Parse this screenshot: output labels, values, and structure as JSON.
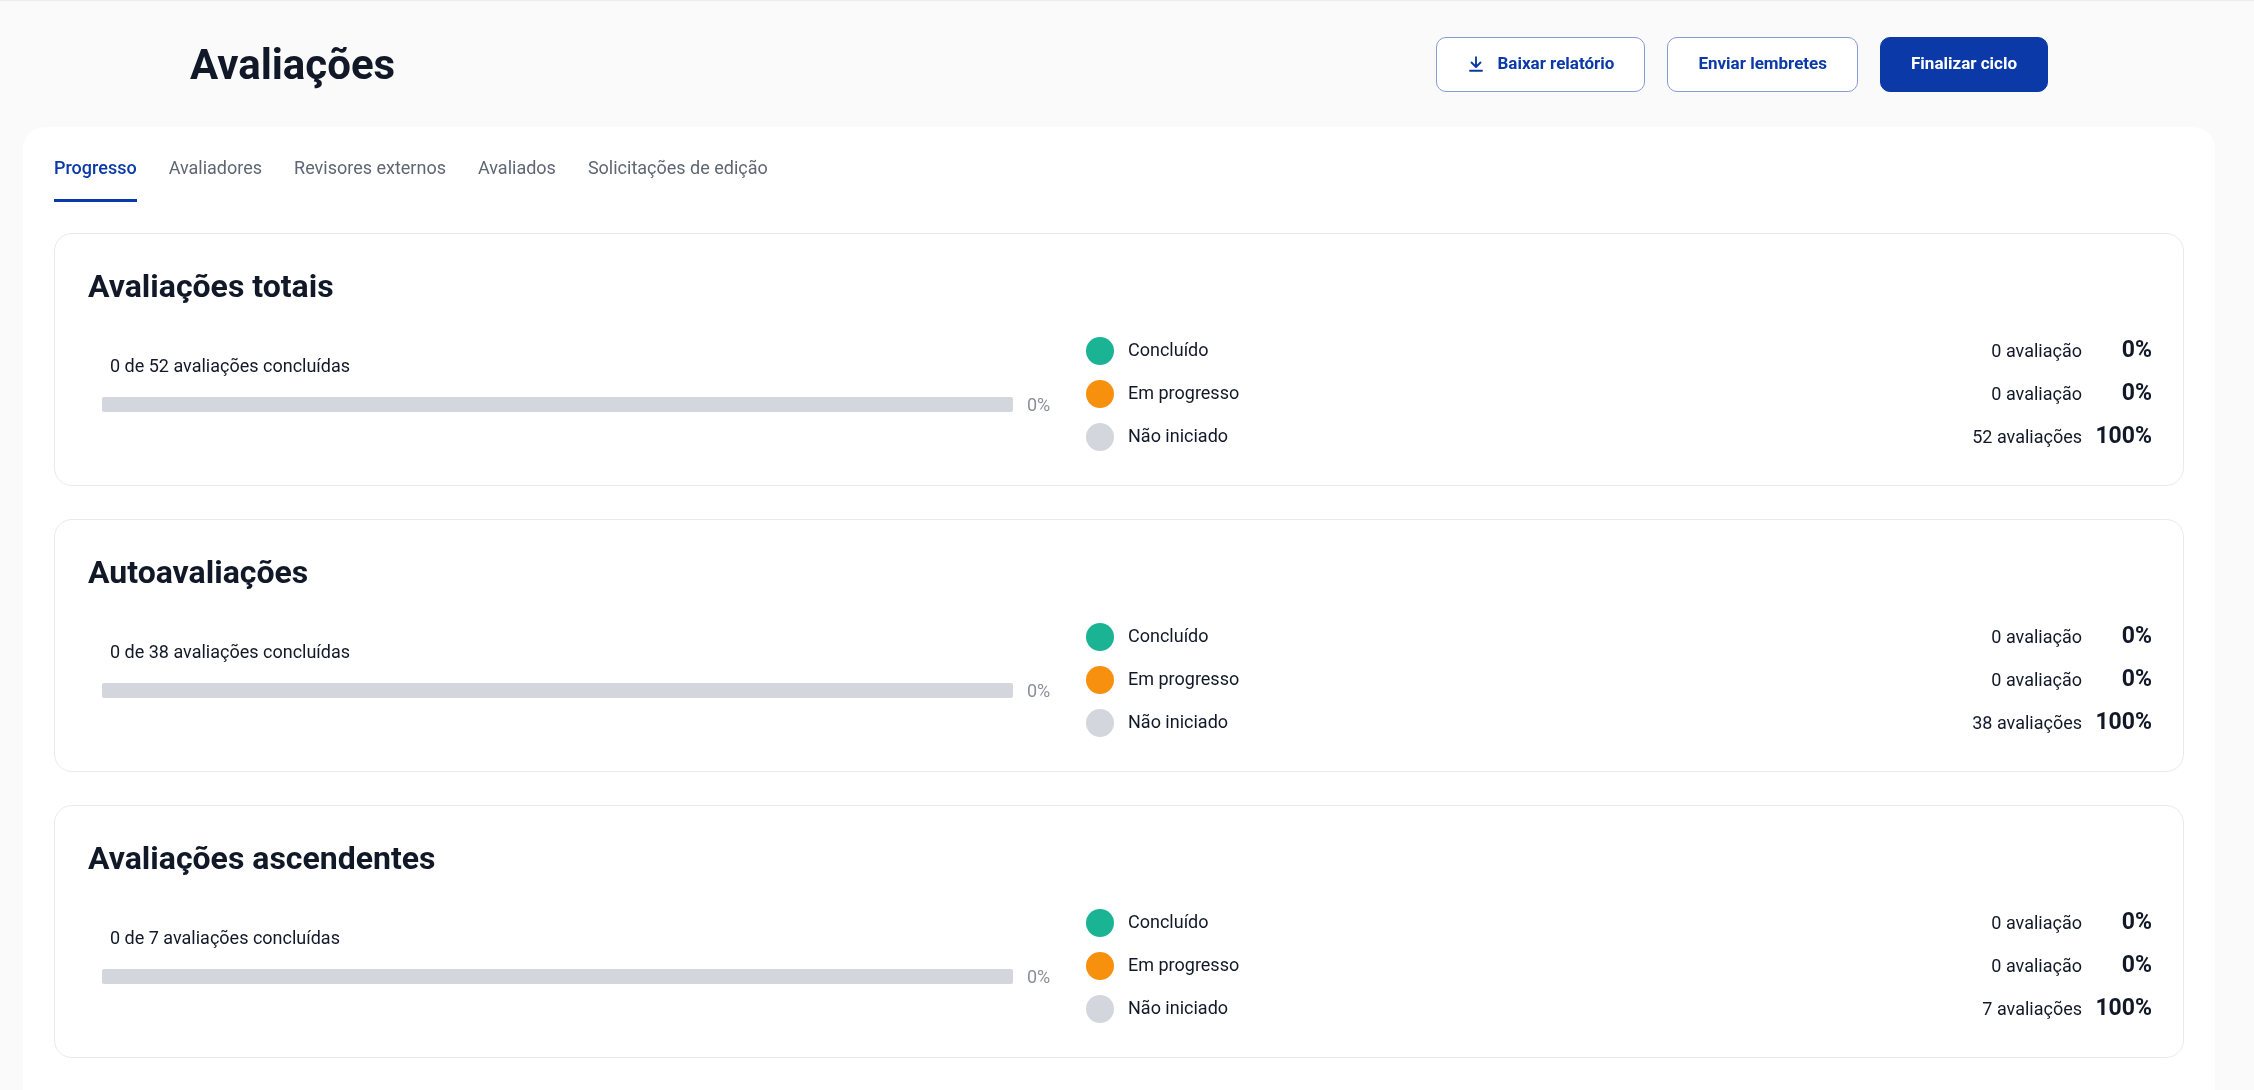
{
  "page": {
    "title": "Avaliações"
  },
  "actions": [
    {
      "label": "Baixar relatório",
      "kind": "download"
    },
    {
      "label": "Enviar lembretes",
      "kind": "outline"
    },
    {
      "label": "Finalizar ciclo",
      "kind": "primary"
    }
  ],
  "tabs": [
    {
      "label": "Progresso",
      "selected": true
    },
    {
      "label": "Avaliadores",
      "selected": false
    },
    {
      "label": "Revisores externos",
      "selected": false
    },
    {
      "label": "Avaliados",
      "selected": false
    },
    {
      "label": "Solicitações de edição",
      "selected": false
    }
  ],
  "cards": [
    {
      "title": "Avaliações totais",
      "summary": "0 de 52 avaliações concluídas",
      "level": 0,
      "percent": "0%",
      "legend": [
        {
          "label": "Concluído",
          "color": "#1ab394",
          "count": "0 avaliação",
          "percent": "0%"
        },
        {
          "label": "Em progresso",
          "color": "#f7910d",
          "count": "0 avaliação",
          "percent": "0%"
        },
        {
          "label": "Não iniciado",
          "color": "#d3d6dc",
          "count": "52 avaliações",
          "percent": "100%"
        }
      ]
    },
    {
      "title": "Autoavaliações",
      "summary": "0 de 38 avaliações concluídas",
      "level": 0,
      "percent": "0%",
      "legend": [
        {
          "label": "Concluído",
          "color": "#1ab394",
          "count": "0 avaliação",
          "percent": "0%"
        },
        {
          "label": "Em progresso",
          "color": "#f7910d",
          "count": "0 avaliação",
          "percent": "0%"
        },
        {
          "label": "Não iniciado",
          "color": "#d3d6dc",
          "count": "38 avaliações",
          "percent": "100%"
        }
      ]
    },
    {
      "title": "Avaliações ascendentes",
      "summary": "0 de 7 avaliações concluídas",
      "level": 0,
      "percent": "0%",
      "legend": [
        {
          "label": "Concluído",
          "color": "#1ab394",
          "count": "0 avaliação",
          "percent": "0%"
        },
        {
          "label": "Em progresso",
          "color": "#f7910d",
          "count": "0 avaliação",
          "percent": "0%"
        },
        {
          "label": "Não iniciado",
          "color": "#d3d6dc",
          "count": "7 avaliações",
          "percent": "100%"
        }
      ]
    }
  ]
}
